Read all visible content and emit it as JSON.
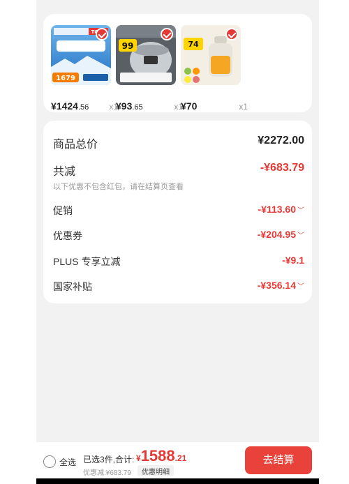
{
  "header": {
    "title": "",
    "right": ""
  },
  "products": [
    {
      "price_int": "¥1424",
      "price_dec": ".56",
      "qty": "x1",
      "badge": "TOP1",
      "sub": "1679"
    },
    {
      "price_int": "¥93",
      "price_dec": ".65",
      "qty": "x1",
      "badge": "99"
    },
    {
      "price_int": "¥70",
      "price_dec": "",
      "qty": "x1",
      "badge": "74"
    }
  ],
  "summary": {
    "subtotal_label": "商品总价",
    "subtotal_value": "¥2272.00",
    "discount_label": "共减",
    "discount_value": "-¥683.79",
    "note": "以下优惠不包含红包，请在结算页查看",
    "items": [
      {
        "label": "促销",
        "value": "-¥113.60"
      },
      {
        "label": "优惠券",
        "value": "-¥204.95"
      },
      {
        "label": "PLUS 专享立减",
        "value": "-¥9.1"
      },
      {
        "label": "国家补贴",
        "value": "-¥356.14"
      }
    ]
  },
  "footer": {
    "select_all": "全选",
    "selected": "已选3件,合计:",
    "total_yen": "¥",
    "total_int": "1588",
    "total_dec": ".21",
    "discount_text": "优惠减:¥683.79",
    "detail_button": "优惠明细",
    "checkout_button": "去结算"
  },
  "colors": {
    "accent": "#e53935",
    "checkout": "#e8423a"
  }
}
